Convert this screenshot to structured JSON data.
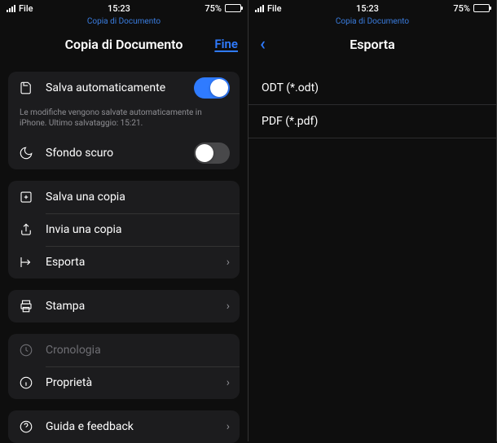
{
  "status": {
    "carrier": "File",
    "time": "15:23",
    "battery_pct": "75%"
  },
  "left": {
    "breadcrumb": "Copia di Documento",
    "title": "Copia di Documento",
    "done": "Fine",
    "autosave": {
      "label": "Salva automaticamente",
      "on": true,
      "hint": "Le modifiche vengono salvate automaticamente in iPhone. Ultimo salvataggio: 15:21."
    },
    "dark_bg": {
      "label": "Sfondo scuro",
      "on": false
    },
    "actions": {
      "save_copy": "Salva una copia",
      "send_copy": "Invia una copia",
      "export": "Esporta"
    },
    "print": "Stampa",
    "history": "Cronologia",
    "properties": "Proprietà",
    "help": "Guida e feedback"
  },
  "right": {
    "breadcrumb": "Copia di Documento",
    "title": "Esporta",
    "formats": [
      "ODT (*.odt)",
      "PDF (*.pdf)"
    ]
  }
}
